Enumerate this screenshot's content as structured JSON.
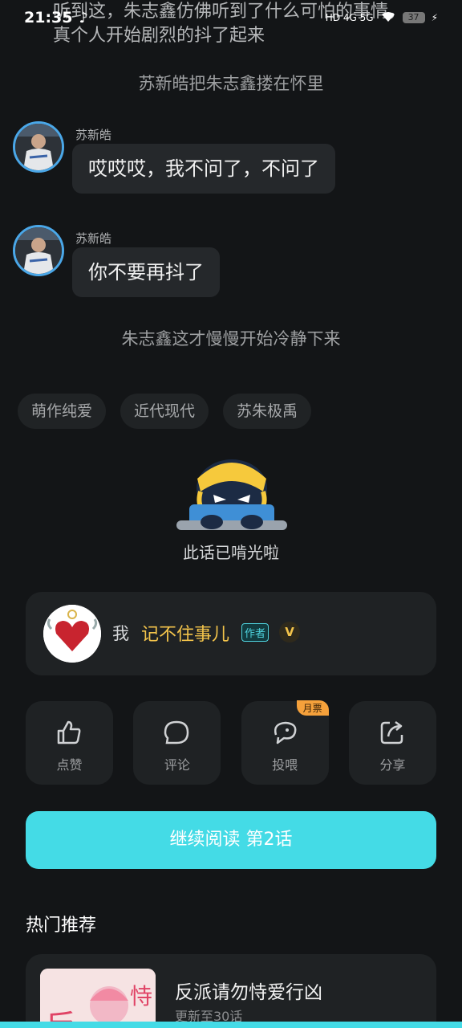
{
  "status_bar": {
    "time": "21:35",
    "indicators": "HD 4G 5G",
    "battery": "37"
  },
  "story": {
    "top_text": "听到这，朱志鑫仿佛听到了什么可怕的事情，真个人开始剧烈的抖了起来",
    "narration_1": "苏新皓把朱志鑫搂在怀里",
    "messages": [
      {
        "sender": "苏新皓",
        "text": "哎哎哎，我不问了，不问了"
      },
      {
        "sender": "苏新皓",
        "text": "你不要再抖了"
      }
    ],
    "narration_2": "朱志鑫这才慢慢开始冷静下来"
  },
  "tags": [
    "萌作纯爱",
    "近代现代",
    "苏朱极禹"
  ],
  "end_text": "此话已啃光啦",
  "author": {
    "me_label": "我",
    "name": "记不住事儿",
    "badge": "作者",
    "vip": "V"
  },
  "actions": [
    {
      "label": "点赞",
      "icon": "thumbs-up-icon"
    },
    {
      "label": "评论",
      "icon": "comment-icon"
    },
    {
      "label": "投喂",
      "icon": "feed-icon",
      "ribbon": "月票"
    },
    {
      "label": "分享",
      "icon": "share-icon"
    }
  ],
  "continue_button": "继续阅读  第2话",
  "hot": {
    "title": "热门推荐",
    "items": [
      {
        "title": "反派请勿恃爱行凶",
        "subtitle": "更新至30话"
      }
    ]
  },
  "colors": {
    "accent": "#44dbe6",
    "author_name": "#f3c44b",
    "ribbon": "#f5a13b",
    "avatar_ring": "#4aa7e8"
  }
}
